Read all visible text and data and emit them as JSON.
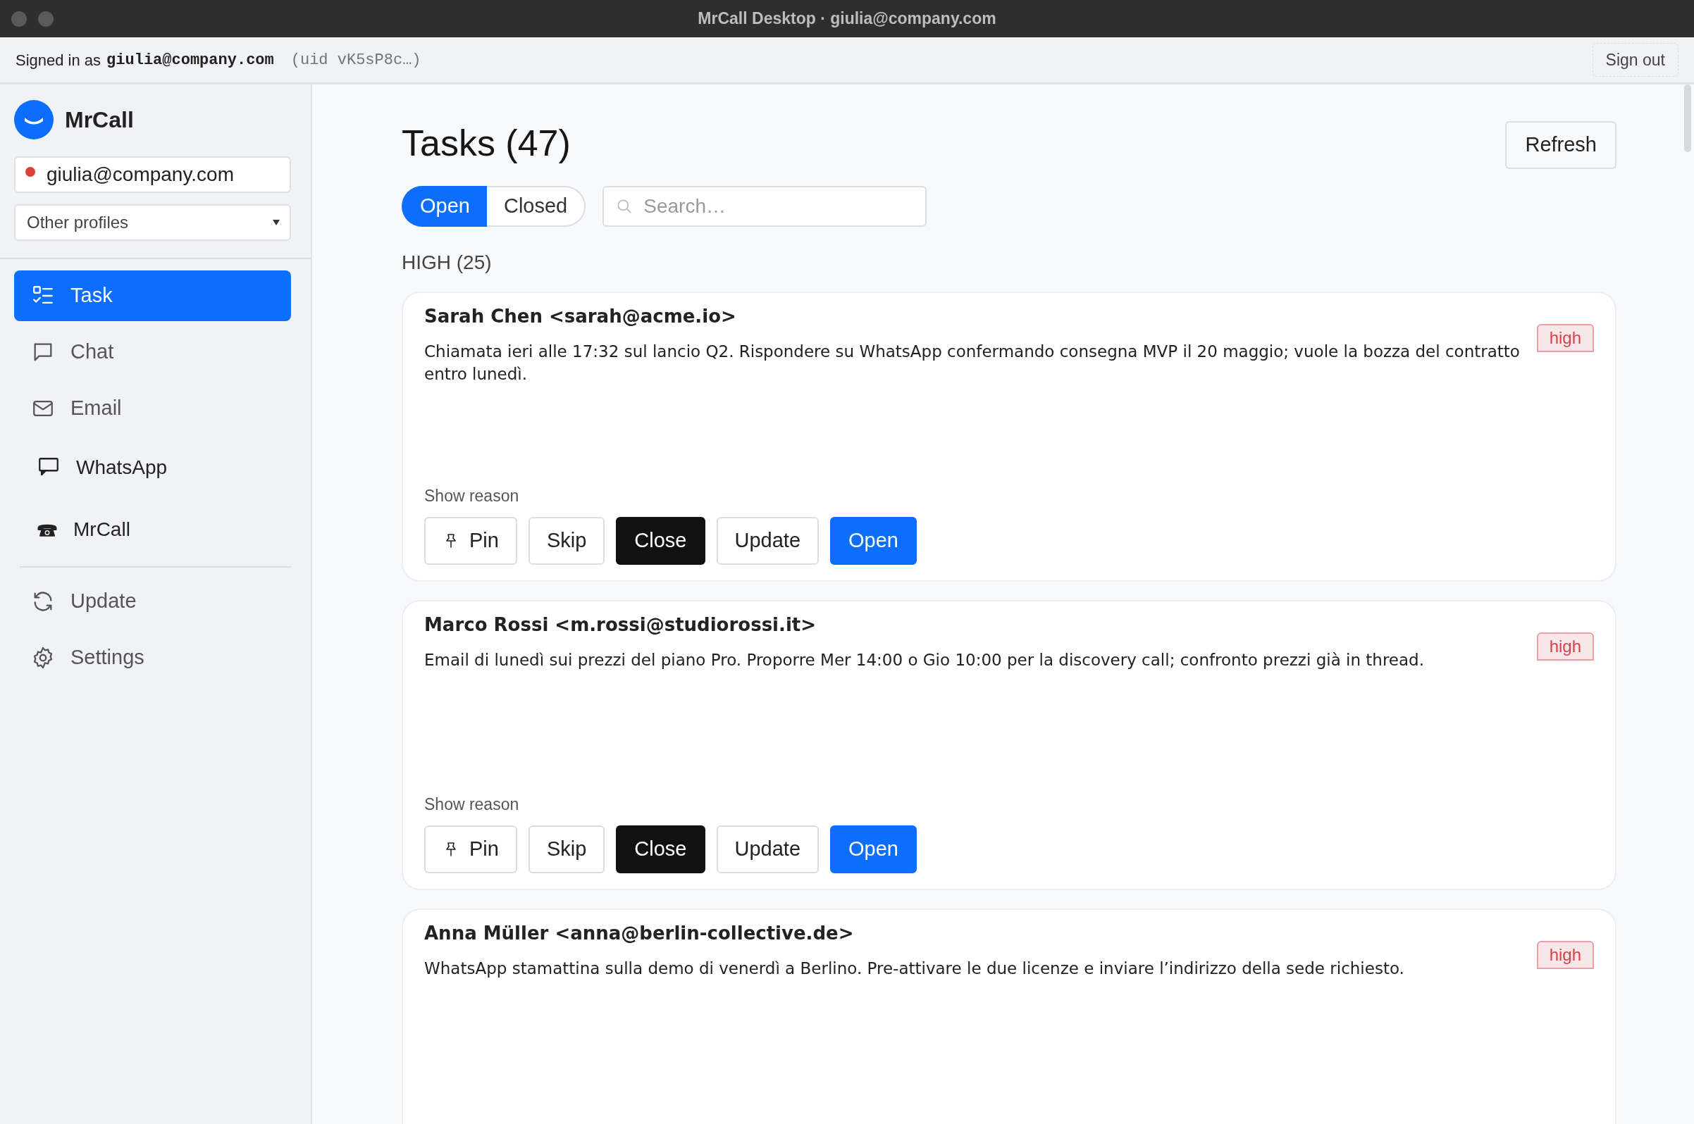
{
  "window": {
    "title": "MrCall Desktop · giulia@company.com"
  },
  "top_bar": {
    "signed_in_label": "Signed in as",
    "email": "giulia@company.com",
    "uid": "(uid vK5sP8c…)",
    "sign_out": "Sign out"
  },
  "sidebar": {
    "brand": "MrCall",
    "account": {
      "value": "giulia@company.com",
      "color": "#d9413a"
    },
    "profiles": {
      "value": "Other profiles"
    },
    "nav": [
      {
        "label": "Task",
        "kind": "task",
        "selected": true
      },
      {
        "label": "Chat",
        "kind": "chat",
        "selected": false
      },
      {
        "label": "Email",
        "kind": "email",
        "selected": false
      },
      {
        "label": "WhatsApp",
        "kind": "whatsapp",
        "selected": false
      },
      {
        "label": "MrCall",
        "kind": "mrcall",
        "selected": false
      }
    ],
    "nav_bottom": [
      {
        "label": "Update",
        "kind": "update",
        "selected": false
      },
      {
        "label": "Settings",
        "kind": "settings",
        "selected": false
      }
    ]
  },
  "main": {
    "title": "Tasks (47)",
    "refresh": "Refresh",
    "filters": [
      {
        "label": "Open",
        "selected": true
      },
      {
        "label": "Closed",
        "selected": false
      }
    ],
    "search": {
      "placeholder": "Search…"
    },
    "group": "HIGH (25)",
    "tasks": [
      {
        "contact": "Sarah Chen <sarah@acme.io>",
        "priority": "high",
        "summary": "Chiamata ieri alle 17:32 sul lancio Q2. Rispondere su WhatsApp confermando consegna MVP il 20 maggio; vuole la bozza del contratto entro lunedì.",
        "reason": "Show reason",
        "actions": [
          {
            "label": "Pin",
            "kind": "pin"
          },
          {
            "label": "Skip",
            "kind": "outline"
          },
          {
            "label": "Close",
            "kind": "dark"
          },
          {
            "label": "Update",
            "kind": "outline"
          },
          {
            "label": "Open",
            "kind": "primary"
          }
        ]
      },
      {
        "contact": "Marco Rossi <m.rossi@studiorossi.it>",
        "priority": "high",
        "summary": "Email di lunedì sui prezzi del piano Pro. Proporre Mer 14:00 o Gio 10:00 per la discovery call; confronto prezzi già in thread.",
        "reason": "Show reason",
        "actions": [
          {
            "label": "Pin",
            "kind": "pin"
          },
          {
            "label": "Skip",
            "kind": "outline"
          },
          {
            "label": "Close",
            "kind": "dark"
          },
          {
            "label": "Update",
            "kind": "outline"
          },
          {
            "label": "Open",
            "kind": "primary"
          }
        ]
      },
      {
        "contact": "Anna Müller <anna@berlin-collective.de>",
        "priority": "high",
        "summary": "WhatsApp stamattina sulla demo di venerdì a Berlino. Pre-attivare le due licenze e inviare l’indirizzo della sede richiesto."
      }
    ]
  }
}
